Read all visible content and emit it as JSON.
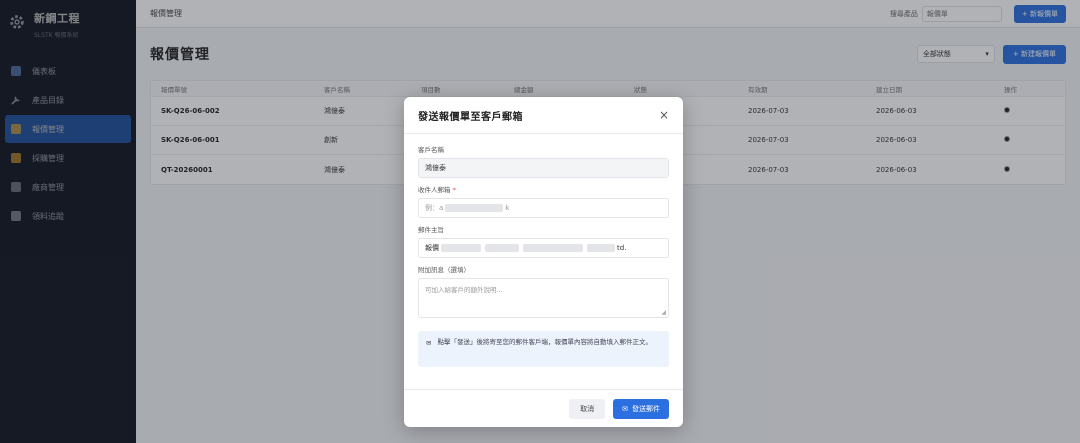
{
  "app": {
    "name": "新鋼工程",
    "subtitle": "SLSTK 報價系統"
  },
  "sidebar": {
    "items": [
      {
        "label": "儀表板",
        "icon": "dashboard-icon",
        "active": false
      },
      {
        "label": "產品目錄",
        "icon": "wrench-icon",
        "active": false
      },
      {
        "label": "報價管理",
        "icon": "document-icon",
        "active": true
      },
      {
        "label": "採購管理",
        "icon": "truck-icon",
        "active": false
      },
      {
        "label": "廠商管理",
        "icon": "factory-icon",
        "active": false
      },
      {
        "label": "領料追蹤",
        "icon": "grid-icon",
        "active": false
      }
    ]
  },
  "topbar": {
    "breadcrumb": "報價管理",
    "search_label": "搜尋產品",
    "search_placeholder": "報價單",
    "new_button": "+ 新報價單"
  },
  "page": {
    "title": "報價管理",
    "filter_value": "全部狀態",
    "new_button": "+ 新建報價單"
  },
  "table": {
    "headers": [
      "報價單號",
      "客戶名稱",
      "項目數",
      "總金額",
      "狀態",
      "有效期",
      "建立日期",
      "操作"
    ],
    "rows": [
      {
        "no": "SK-Q26-06-002",
        "customer": "鴻億泰",
        "valid": "2026-07-03",
        "created": "2026-06-03"
      },
      {
        "no": "SK-Q26-06-001",
        "customer": "創新",
        "valid": "2026-07-03",
        "created": "2026-06-03"
      },
      {
        "no": "QT-20260001",
        "customer": "鴻億泰",
        "valid": "2026-07-03",
        "created": "2026-06-03"
      }
    ]
  },
  "modal": {
    "title": "發送報價單至客戶郵箱",
    "close": "×",
    "customer_label": "客戶名稱",
    "customer_value": "鴻億泰",
    "email_label": "收件人郵箱",
    "email_required": "*",
    "email_prefix": "例：a",
    "email_suffix": "k",
    "subject_label": "郵件主旨",
    "subject_prefix": "報價",
    "subject_suffix": "td.",
    "message_label": "附加訊息（選填）",
    "message_placeholder": "可加入給客戶的額外說明...",
    "resize_grip": "◢",
    "info_text": "點擊「發送」後將寄至您的郵件客戶端，報價單內容將自動填入郵件正文。",
    "info_icon": "mail-icon",
    "cancel": "取消",
    "send": "發送郵件"
  },
  "colors": {
    "sidebar_bg": "#1c2333",
    "accent": "#2c6fe0",
    "info_bg": "#edf3fd"
  }
}
